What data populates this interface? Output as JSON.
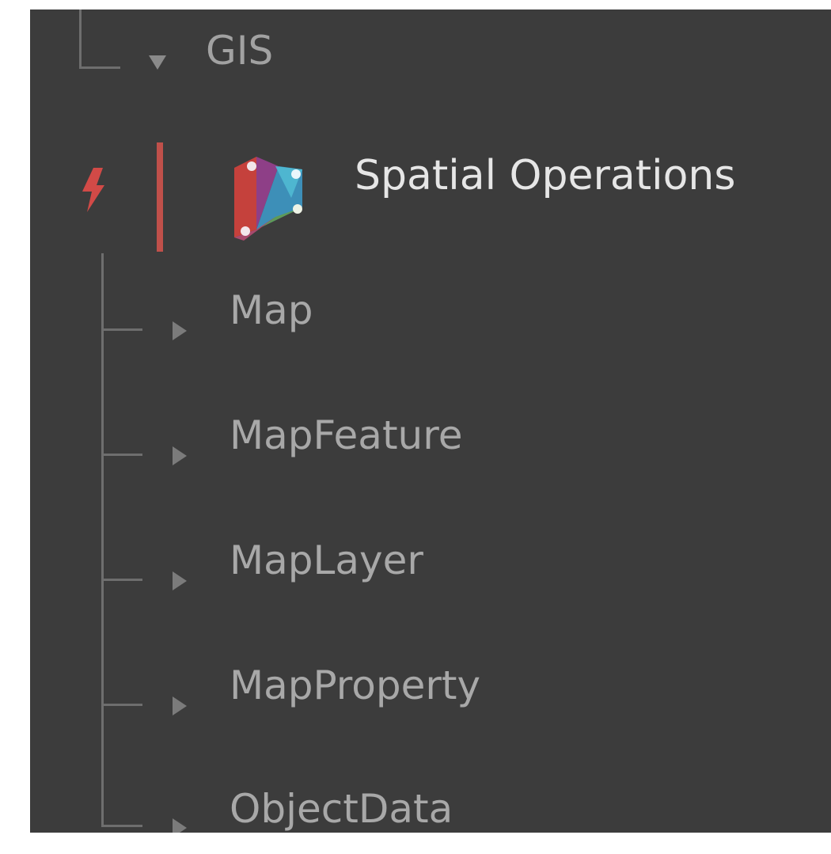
{
  "tree": {
    "parent_label": "GIS",
    "selected_label": "Spatial Operations",
    "children": [
      {
        "label": "Map"
      },
      {
        "label": "MapFeature"
      },
      {
        "label": "MapLayer"
      },
      {
        "label": "MapProperty"
      },
      {
        "label": "ObjectData"
      }
    ]
  },
  "colors": {
    "panel_bg": "#3c3c3c",
    "accent_red": "#c0504a",
    "text_dim": "#a8a8a8",
    "text_bright": "#e6e6e6"
  },
  "icons": {
    "package_status": "lightning-bolt-icon",
    "package_logo": "dynamo-logo-icon",
    "expanded": "triangle-down-icon",
    "collapsed": "triangle-right-icon"
  }
}
